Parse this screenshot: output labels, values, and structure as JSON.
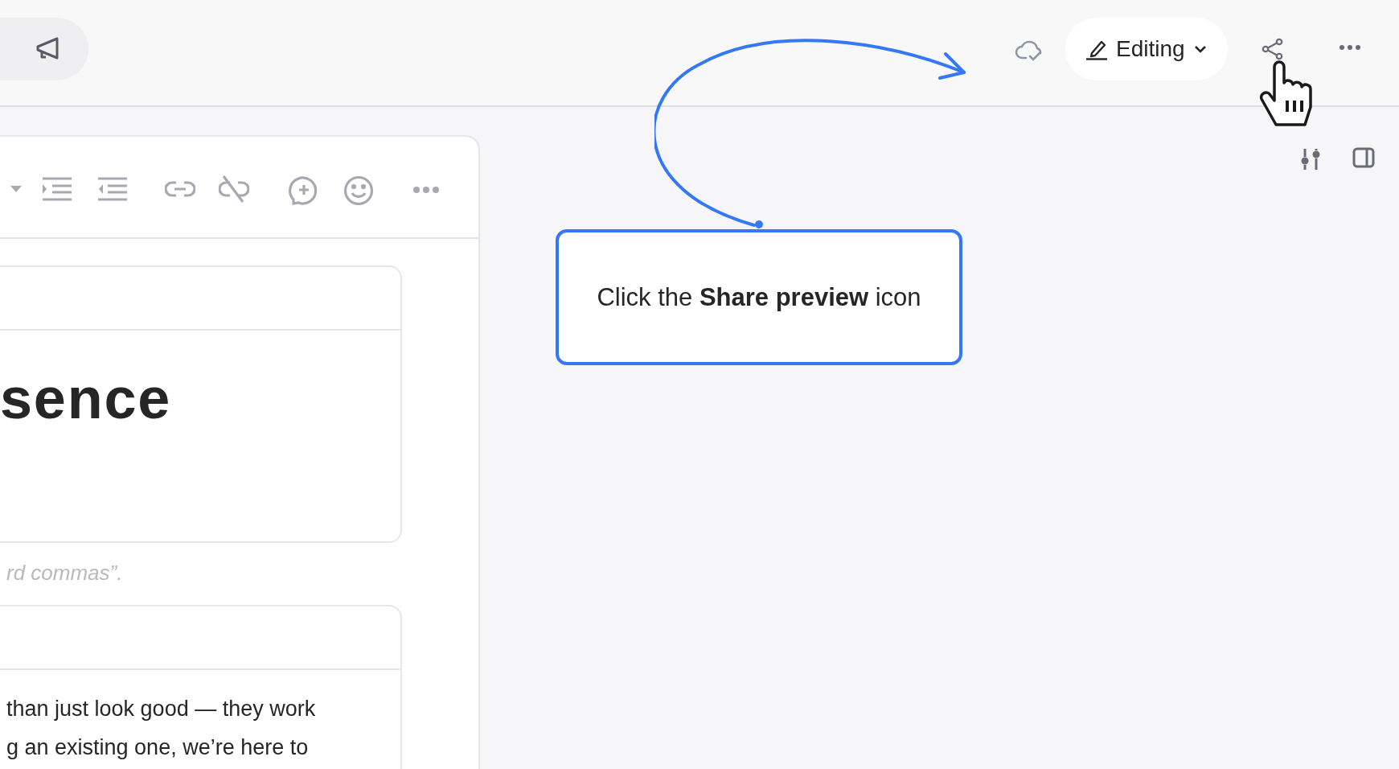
{
  "top_bar": {
    "mode_button": {
      "label": "Editing"
    }
  },
  "editor": {
    "heading": "sence",
    "caption": "rd commas”.",
    "body_lines": [
      "than just look good — they work",
      "g an existing one, we’re here to"
    ]
  },
  "callout": {
    "text": "Click the **Share preview** icon"
  }
}
